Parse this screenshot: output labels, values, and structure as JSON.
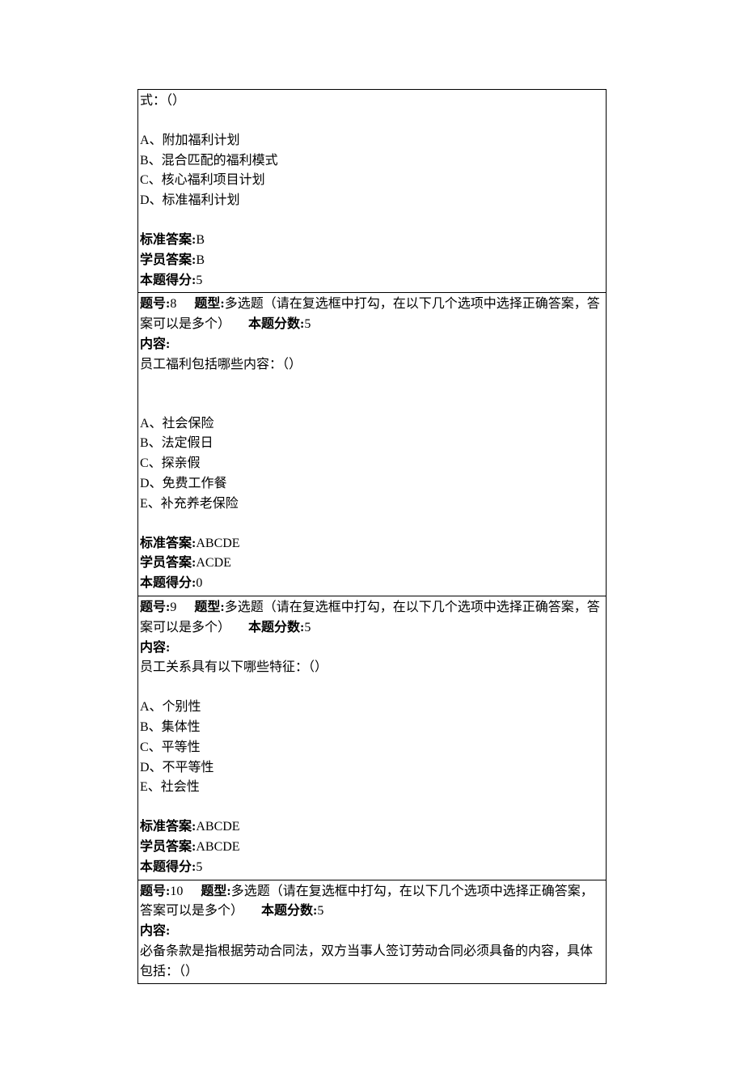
{
  "labels": {
    "question_no": "题号:",
    "question_type": "题型:",
    "question_score": "本题分数:",
    "content": "内容:",
    "correct_answer": "标准答案:",
    "student_answer": "学员答案:",
    "earned_score": "本题得分:"
  },
  "q7_tail": {
    "stem_line1": "式：（）",
    "options": [
      "A、附加福利计划",
      "B、混合匹配的福利模式",
      "C、核心福利项目计划",
      "D、标准福利计划"
    ],
    "correct": "B",
    "student": "B",
    "earned": "5"
  },
  "q8": {
    "no": "8",
    "type_desc": "多选题（请在复选框中打勾，在以下几个选项中选择正确答案，答案可以是多个）",
    "score": "5",
    "stem": "员工福利包括哪些内容：（）",
    "options": [
      "A、社会保险",
      "B、法定假日",
      "C、探亲假",
      "D、免费工作餐",
      "E、补充养老保险"
    ],
    "correct": "ABCDE",
    "student": "ACDE",
    "earned": "0"
  },
  "q9": {
    "no": "9",
    "type_desc": "多选题（请在复选框中打勾，在以下几个选项中选择正确答案，答案可以是多个）",
    "score": "5",
    "stem": "员工关系具有以下哪些特征：（）",
    "options": [
      "A、个别性",
      "B、集体性",
      "C、平等性",
      "D、不平等性",
      "E、社会性"
    ],
    "correct": "ABCDE",
    "student": "ABCDE",
    "earned": "5"
  },
  "q10": {
    "no": "10",
    "type_desc": "多选题（请在复选框中打勾，在以下几个选项中选择正确答案，答案可以是多个）",
    "score": "5",
    "stem": "必备条款是指根据劳动合同法，双方当事人签订劳动合同必须具备的内容，具体包括：（）"
  }
}
